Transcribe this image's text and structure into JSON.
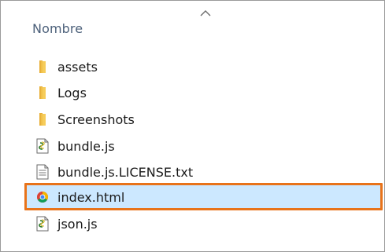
{
  "header": {
    "column_name": "Nombre",
    "sort_icon": "chevron-up-icon"
  },
  "files": [
    {
      "name": "assets",
      "icon": "folder-icon",
      "selected": false
    },
    {
      "name": "Logs",
      "icon": "folder-icon",
      "selected": false
    },
    {
      "name": "Screenshots",
      "icon": "folder-icon",
      "selected": false
    },
    {
      "name": "bundle.js",
      "icon": "script-file-icon",
      "selected": false
    },
    {
      "name": "bundle.js.LICENSE.txt",
      "icon": "text-file-icon",
      "selected": false
    },
    {
      "name": "index.html",
      "icon": "chrome-html-file-icon",
      "selected": true
    },
    {
      "name": "json.js",
      "icon": "script-file-icon",
      "selected": false
    }
  ],
  "colors": {
    "selection_bg": "#cce8ff",
    "highlight_border": "#e8731a",
    "header_text": "#4c607a",
    "folder": "#f4c247"
  }
}
